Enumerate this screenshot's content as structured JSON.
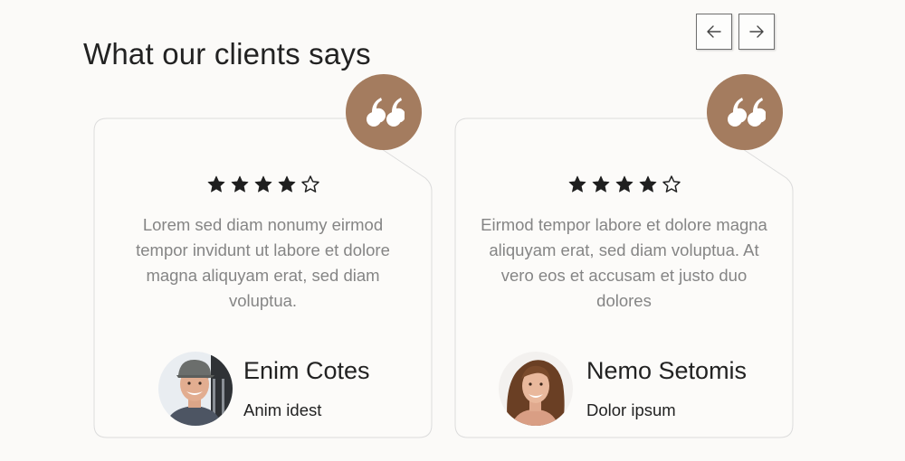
{
  "section": {
    "title": "What our clients says"
  },
  "navigation": {
    "prev_icon": "arrow-left-icon",
    "next_icon": "arrow-right-icon"
  },
  "colors": {
    "accent": "#a47c5f",
    "text": "#222222",
    "muted": "#858585",
    "border": "#dcdcdc"
  },
  "testimonials": [
    {
      "rating": 4,
      "max_rating": 5,
      "text": "Lorem sed diam nonumy eirmod tempor invidunt ut labore et dolore magna aliquyam erat, sed diam voluptua.",
      "name": "Enim Cotes",
      "role": "Anim idest",
      "avatar": "man-with-cap-avatar"
    },
    {
      "rating": 4,
      "max_rating": 5,
      "text": "Eirmod tempor labore et dolore magna aliquyam erat, sed diam voluptua. At vero eos et accusam et justo duo dolores",
      "name": "Nemo Setomis",
      "role": "Dolor ipsum",
      "avatar": "smiling-woman-avatar"
    }
  ]
}
